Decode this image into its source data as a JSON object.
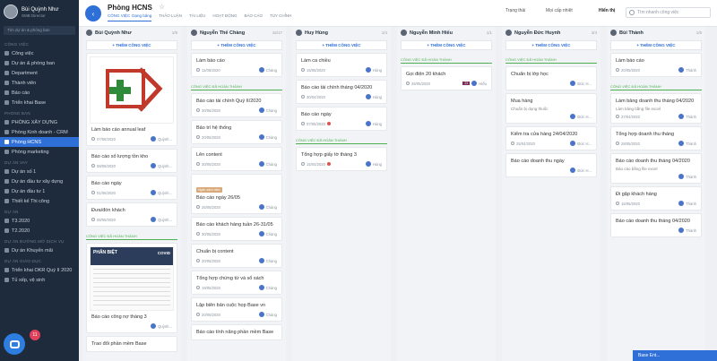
{
  "sidebar": {
    "user_name": "Bùi Quỳnh Như",
    "user_role": "SMB Director",
    "search_placeholder": "Tìm dự án & phòng ban",
    "sections": [
      {
        "title": "Công việc",
        "items": [
          {
            "label": "Công việc"
          },
          {
            "label": "Dự án & phòng ban"
          },
          {
            "label": "Department"
          },
          {
            "label": "Thành viên"
          },
          {
            "label": "Báo cáo"
          },
          {
            "label": "Triển khai Base"
          }
        ]
      },
      {
        "title": "Phòng ban",
        "items": [
          {
            "label": "PHÒNG XÂY DỰNG"
          },
          {
            "label": "Phòng Kinh doanh - CRM"
          },
          {
            "label": "Phòng HCNS",
            "active": true
          },
          {
            "label": "Phòng marketing"
          }
        ]
      },
      {
        "title": "Dự án vay",
        "items": [
          {
            "label": "Dự án số 1"
          },
          {
            "label": "Dự án đầu tư xây dựng"
          },
          {
            "label": "Dự án đầu tư 1"
          },
          {
            "label": "Thiết kế Thi công"
          }
        ]
      },
      {
        "title": "Dự án",
        "items": [
          {
            "label": "T3.2020"
          },
          {
            "label": "T2.2020"
          }
        ]
      },
      {
        "title": "Dự án đường mở dịch vụ",
        "items": [
          {
            "label": "Dự án Khuyến mãi"
          }
        ]
      },
      {
        "title": "Dự án Giáo dục",
        "items": [
          {
            "label": "Triển khai OKR Quý II 2020"
          },
          {
            "label": "Tủ xếp, vệ sinh"
          }
        ]
      }
    ],
    "chat_badge": "11"
  },
  "header": {
    "title": "Phòng HCNS",
    "tabs": [
      "Công việc",
      "Thảo luận",
      "Tài liệu",
      "Hoạt động",
      "Báo cáo",
      "Tùy chỉnh"
    ],
    "tab_active_suffix": "Dạng bảng",
    "filter_status": "Trạng thái",
    "filter_level": "Mọi cấp nhiệt",
    "filter_view": "Hiển thị",
    "search_placeholder": "Tìm nhanh công việc"
  },
  "done_label": "Công việc đã hoàn thành",
  "add_label": "+ THÊM CÔNG VIỆC",
  "columns": [
    {
      "name": "Bùi Quỳnh Như",
      "count": "1/9",
      "cards": [
        {
          "image": "logo",
          "title": "Làm báo cáo annual leaf",
          "date": "07/06/2020",
          "user": "Quỳnh..."
        },
        {
          "title": "Báo cáo số lượng tồn kho",
          "date": "08/06/2020",
          "user": "Quỳnh..."
        },
        {
          "title": "Báo cáo ngày",
          "date": "01/06/2020",
          "user": "Quỳnh..."
        },
        {
          "title": "Đưa/đón khách",
          "date": "08/05/2020",
          "user": "Quỳnh..."
        }
      ],
      "done": [
        {
          "image": "covid",
          "title": "Báo cáo công nợ tháng 3",
          "date": "",
          "user": "Quỳnh..."
        },
        {
          "title": "Trao đổi phần mềm Base",
          "date": "",
          "user": ""
        }
      ]
    },
    {
      "name": "Nguyễn Thế Chàng",
      "count": "16/17",
      "cards": [
        {
          "title": "Làm báo cáo",
          "date": "11/05/2020",
          "user": "Chàng"
        }
      ],
      "done": [
        {
          "title": "Báo cáo tài chính Quý II/2020",
          "date": "30/06/2020",
          "user": "Chàng"
        },
        {
          "title": "Bảo trì hệ thống",
          "date": "20/05/2020",
          "user": "Chàng"
        },
        {
          "title": "Lên content",
          "date": "30/05/2020",
          "user": "Chàng"
        },
        {
          "badge": "Ngân sách năm",
          "title": "Báo cáo ngày 26/05",
          "date": "26/05/2020",
          "user": "Chàng"
        },
        {
          "title": "Báo cáo khách hàng tuần 26-31/05",
          "date": "30/05/2020",
          "user": "Chàng"
        },
        {
          "title": "Chuẩn bị content",
          "date": "20/05/2020",
          "user": "Chàng"
        },
        {
          "title": "Tổng hợp chứng từ và sổ sách",
          "date": "19/05/2020",
          "user": "Chàng"
        },
        {
          "title": "Lập biên bản cuộc họp Base vn",
          "date": "20/05/2020",
          "user": "Chàng"
        },
        {
          "title": "Báo cáo tính năng phần mềm Base",
          "date": "",
          "user": ""
        }
      ]
    },
    {
      "name": "Huy Hùng",
      "count": "1/4",
      "cards": [
        {
          "title": "Làm ca chiều",
          "date": "15/05/2020",
          "user": "Hùng"
        },
        {
          "title": "Báo cáo tài chính tháng 04/2020",
          "date": "30/04/2020",
          "user": "Hùng"
        },
        {
          "title": "Báo cáo ngày",
          "date": "07/05/2020",
          "user": "Hùng",
          "alert": true
        }
      ],
      "done": [
        {
          "title": "Tổng hợp giấy tờ tháng 3",
          "date": "15/04/2020",
          "user": "Hùng",
          "alert": true
        }
      ]
    },
    {
      "name": "Nguyễn Minh Hiếu",
      "count": "1/1",
      "cards": [],
      "done": [
        {
          "title": "Gọi điện 20 khách",
          "date": "26/05/2020",
          "user": "Hiếu",
          "userBadge": "21"
        }
      ]
    },
    {
      "name": "Nguyễn Đức Huynh",
      "count": "4/4",
      "cards": [],
      "done": [
        {
          "title": "Chuẩn bị lớp học",
          "date": "",
          "user": "Đức H..."
        },
        {
          "title": "Mua hàng",
          "sub": "Chuẩn bị dụng thuốc",
          "date": "",
          "user": "Đức H..."
        },
        {
          "title": "Kiểm tra cửa hàng 24/04/2020",
          "date": "25/04/2020",
          "user": "Đức H..."
        },
        {
          "title": "Báo cáo doanh thu ngày",
          "date": "",
          "user": "Đức H..."
        }
      ]
    },
    {
      "name": "Bùi Thành",
      "count": "1/8",
      "cards": [
        {
          "title": "Làm báo cáo",
          "date": "20/05/2020",
          "user": "Thành"
        }
      ],
      "done": [
        {
          "title": "Làm bảng doanh thu tháng 04/2020",
          "sub": "Làm bảng bằng file excel",
          "date": "27/04/2020",
          "user": "Thành"
        },
        {
          "title": "Tổng hợp doanh thu tháng",
          "date": "28/05/2020",
          "user": "Thành"
        },
        {
          "title": "Báo cáo doanh thu tháng 04/2020",
          "sub": "Báo cáo bằng file excel",
          "date": "",
          "user": "Thành"
        },
        {
          "title": "Đi gặp khách hàng",
          "date": "15/05/2020",
          "user": "Thành"
        },
        {
          "title": "Báo cáo doanh thu tháng 04/2020",
          "date": "",
          "user": "Thành"
        }
      ]
    }
  ],
  "float_bar": "Base Ent...",
  "image_text": {
    "covid_title": "PHÂN BIỆT",
    "covid_corner": "COVID"
  }
}
